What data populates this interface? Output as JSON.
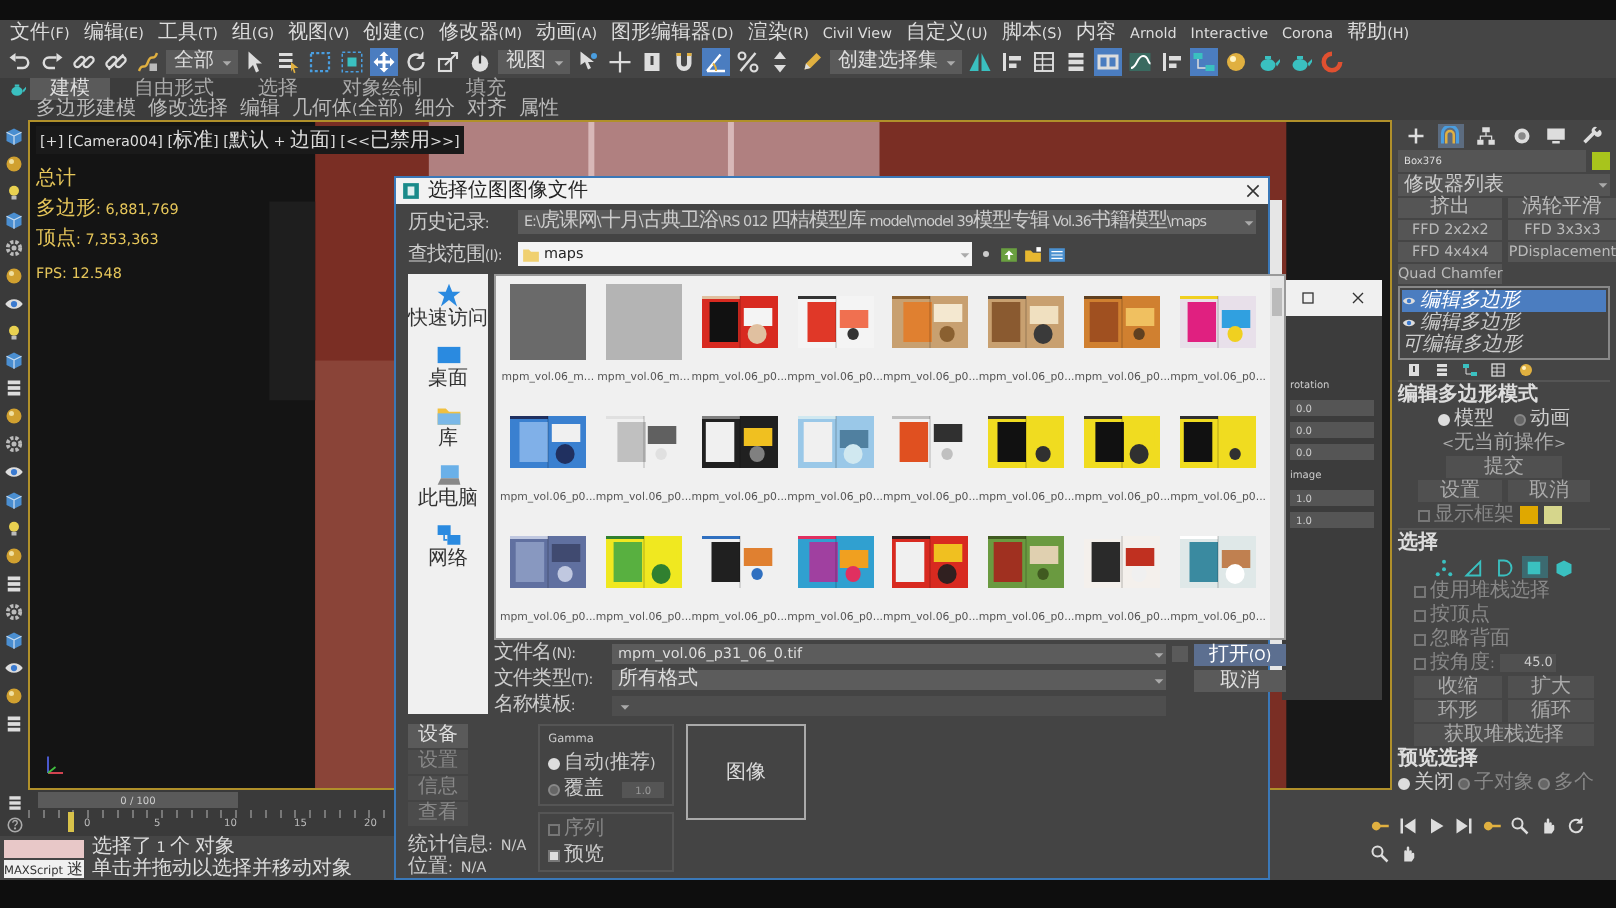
{
  "menu": [
    "文件(F)",
    "编辑(E)",
    "工具(T)",
    "组(G)",
    "视图(V)",
    "创建(C)",
    "修改器(M)",
    "动画(A)",
    "图形编辑器(D)",
    "渲染(R)",
    "Civil View",
    "自定义(U)",
    "脚本(S)",
    "内容",
    "Arnold",
    "Interactive",
    "Corona",
    "帮助(H)"
  ],
  "toolbar": [
    {
      "kind": "undo",
      "selected": false
    },
    {
      "kind": "redo",
      "selected": false
    },
    {
      "kind": "link",
      "selected": false
    },
    {
      "kind": "unlink",
      "selected": false
    },
    {
      "kind": "bind",
      "selected": false
    },
    {
      "kind": "dropdown",
      "text": "全部"
    },
    {
      "kind": "select",
      "selected": false
    },
    {
      "kind": "list",
      "selected": false
    },
    {
      "kind": "rect-select",
      "selected": false
    },
    {
      "kind": "window-select",
      "selected": false
    },
    {
      "kind": "move",
      "selected": true
    },
    {
      "kind": "rotate",
      "selected": false
    },
    {
      "kind": "scale",
      "selected": false
    },
    {
      "kind": "place",
      "selected": false
    },
    {
      "kind": "dropdown",
      "text": "视图"
    },
    {
      "kind": "pivot",
      "selected": false
    },
    {
      "kind": "crosshair",
      "selected": false
    },
    {
      "kind": "pin",
      "selected": false
    },
    {
      "kind": "snap",
      "selected": false
    },
    {
      "kind": "angle",
      "selected": true
    },
    {
      "kind": "percent",
      "selected": false
    },
    {
      "kind": "spinner",
      "selected": false
    },
    {
      "kind": "pencil",
      "selected": false
    },
    {
      "kind": "dropdown",
      "text": "创建选择集"
    },
    {
      "kind": "mirror",
      "selected": false
    },
    {
      "kind": "align",
      "selected": false
    },
    {
      "kind": "table",
      "selected": false
    },
    {
      "kind": "layers",
      "selected": false
    },
    {
      "kind": "ribbon",
      "selected": true
    },
    {
      "kind": "curve",
      "selected": false
    },
    {
      "kind": "align",
      "selected": false
    },
    {
      "kind": "schematic",
      "selected": true
    },
    {
      "kind": "material",
      "selected": false
    },
    {
      "kind": "teapot",
      "selected": false
    },
    {
      "kind": "teapot",
      "selected": false
    },
    {
      "kind": "render",
      "selected": false
    }
  ],
  "ribbon": {
    "tabs": [
      {
        "label": "建模",
        "selected": true
      },
      {
        "label": "自由形式",
        "selected": false
      },
      {
        "label": "选择",
        "selected": false
      },
      {
        "label": "对象绘制",
        "selected": false
      },
      {
        "label": "填充",
        "selected": false
      }
    ],
    "items": [
      "多边形建模",
      "修改选择",
      "编辑",
      "几何体(全部)",
      "细分",
      "对齐",
      "属性"
    ]
  },
  "left_toolbar": [
    {
      "kind": "box"
    },
    {
      "kind": "sphere"
    },
    {
      "kind": "light"
    },
    {
      "kind": "box"
    },
    {
      "kind": "gear"
    },
    {
      "kind": "sphere"
    },
    {
      "kind": "eye"
    },
    {
      "kind": "light"
    },
    {
      "kind": "box"
    },
    {
      "kind": "layers"
    },
    {
      "kind": "sphere"
    },
    {
      "kind": "gear"
    },
    {
      "kind": "eye"
    },
    {
      "kind": "box"
    },
    {
      "kind": "light"
    },
    {
      "kind": "sphere"
    },
    {
      "kind": "layers"
    },
    {
      "kind": "gear"
    },
    {
      "kind": "box"
    },
    {
      "kind": "eye"
    },
    {
      "kind": "sphere"
    },
    {
      "kind": "layers"
    }
  ],
  "viewport": {
    "label": "[+] [Camera004] [标准] [默认 + 边面] [<<已禁用>>]",
    "stats_title": "总计",
    "stats": [
      {
        "label": "多边形:",
        "value": "6,881,769"
      },
      {
        "label": "顶点:",
        "value": "7,353,363"
      }
    ],
    "fps": {
      "label": "FPS:",
      "value": "12.548"
    }
  },
  "command_panel": {
    "tabs": [
      {
        "kind": "create",
        "selected": false
      },
      {
        "kind": "modify",
        "selected": true
      },
      {
        "kind": "hierarchy",
        "selected": false
      },
      {
        "kind": "motion",
        "selected": false
      },
      {
        "kind": "display",
        "selected": false
      },
      {
        "kind": "utilities",
        "selected": false
      }
    ],
    "object": {
      "name": "Box376",
      "color": "#a8c41c"
    },
    "modifier_list": "修改器列表",
    "modifier_buttons": [
      "挤出",
      "涡轮平滑",
      "FFD 2x2x2",
      "FFD 3x3x3",
      "FFD 4x4x4",
      "PDisplacement",
      "Quad Chamfer"
    ],
    "stack": [
      {
        "label": "编辑多边形",
        "selected": true,
        "visible": true
      },
      {
        "label": "编辑多边形",
        "selected": false,
        "visible": true
      },
      {
        "label": "可编辑多边形",
        "selected": false,
        "visible": false
      }
    ],
    "edit_mode": {
      "title": "编辑多边形模式",
      "options": [
        {
          "label": "模型",
          "selected": true
        },
        {
          "label": "动画",
          "selected": false
        }
      ],
      "status": "<无当前操作>",
      "commit": "提交",
      "buttons": [
        "设置",
        "取消"
      ],
      "show_cage": {
        "label": "显示框架",
        "checked": false
      },
      "cage_colors": [
        {
          "color": "#e0a800"
        },
        {
          "color": "#d6d68c"
        }
      ]
    },
    "selection": {
      "title": "选择",
      "levels": [
        {
          "kind": "vertex",
          "selected": false
        },
        {
          "kind": "edge",
          "selected": false
        },
        {
          "kind": "border",
          "selected": false
        },
        {
          "kind": "polygon",
          "selected": true
        },
        {
          "kind": "element",
          "selected": false
        }
      ],
      "checks": [
        {
          "label": "使用堆栈选择",
          "checked": false
        },
        {
          "label": "按顶点",
          "checked": false
        },
        {
          "label": "忽略背面",
          "checked": false
        },
        {
          "label": "按角度:",
          "checked": false,
          "value": "45.0"
        }
      ],
      "buttons": [
        "收缩",
        "扩大",
        "环形",
        "循环"
      ],
      "get_stack": "获取堆栈选择",
      "preview": {
        "title": "预览选择",
        "options": [
          {
            "label": "关闭",
            "selected": true
          },
          {
            "label": "子对象",
            "selected": false
          },
          {
            "label": "多个",
            "selected": false
          }
        ]
      }
    }
  },
  "timeline": {
    "frame": "0 / 100",
    "level": 0,
    "ticks": [
      "0",
      "5",
      "10",
      "15",
      "20"
    ]
  },
  "status_bar": {
    "script_label": "MAXScript 迷",
    "selection": "选择了 1 个 对象",
    "prompt": "单击并拖动以选择并移动对象"
  },
  "background_window": {
    "sections": [
      {
        "title": "rotation",
        "fields": [
          "0.0",
          "0.0",
          "0.0"
        ]
      },
      {
        "title": "image",
        "fields": [
          "1.0",
          "1.0"
        ]
      }
    ]
  },
  "dialog": {
    "title": "选择位图图像文件",
    "history": {
      "label": "历史记录:",
      "value": "E:\\虎课网\\十月\\古典卫浴\\RS 012 四桔模型库 model\\model 39模型专辑 Vol.36书籍模型\\maps"
    },
    "look_in": {
      "label": "查找范围(I):",
      "value": "maps"
    },
    "places": [
      "快速访问",
      "桌面",
      "库",
      "此电脑",
      "网络"
    ],
    "files": [
      {
        "name": "mpm_vol.06_m...",
        "kind": "placeholder",
        "color": "#6a6a6a"
      },
      {
        "name": "mpm_vol.06_m...",
        "kind": "placeholder",
        "color": "#b4b4b4"
      },
      {
        "name": "mpm_vol.06_p0...",
        "kind": "picture"
      },
      {
        "name": "mpm_vol.06_p0...",
        "kind": "picture"
      },
      {
        "name": "mpm_vol.06_p0...",
        "kind": "picture"
      },
      {
        "name": "mpm_vol.06_p0...",
        "kind": "picture"
      },
      {
        "name": "mpm_vol.06_p0...",
        "kind": "picture"
      },
      {
        "name": "mpm_vol.06_p0...",
        "kind": "picture"
      },
      {
        "name": "mpm_vol.06_p0...",
        "kind": "picture"
      },
      {
        "name": "mpm_vol.06_p0...",
        "kind": "picture"
      },
      {
        "name": "mpm_vol.06_p0...",
        "kind": "picture"
      },
      {
        "name": "mpm_vol.06_p0...",
        "kind": "picture"
      },
      {
        "name": "mpm_vol.06_p0...",
        "kind": "picture"
      },
      {
        "name": "mpm_vol.06_p0...",
        "kind": "picture"
      },
      {
        "name": "mpm_vol.06_p0...",
        "kind": "picture"
      },
      {
        "name": "mpm_vol.06_p0...",
        "kind": "picture"
      },
      {
        "name": "mpm_vol.06_p0...",
        "kind": "picture"
      },
      {
        "name": "mpm_vol.06_p0...",
        "kind": "picture"
      },
      {
        "name": "mpm_vol.06_p0...",
        "kind": "picture"
      },
      {
        "name": "mpm_vol.06_p0...",
        "kind": "picture"
      },
      {
        "name": "mpm_vol.06_p0...",
        "kind": "picture"
      },
      {
        "name": "mpm_vol.06_p0...",
        "kind": "picture"
      },
      {
        "name": "mpm_vol.06_p0...",
        "kind": "picture"
      },
      {
        "name": "mpm_vol.06_p0...",
        "kind": "picture"
      }
    ],
    "fields": [
      {
        "label": "文件名(N):",
        "value": "mpm_vol.06_p31_06_0.tif"
      },
      {
        "label": "文件类型(T):",
        "value": "所有格式"
      },
      {
        "label": "名称模板:"
      }
    ],
    "open": "打开(O)",
    "cancel": "取消",
    "side_buttons": [
      {
        "label": "设备",
        "disabled": false
      },
      {
        "label": "设置",
        "disabled": true
      },
      {
        "label": "信息",
        "disabled": true
      },
      {
        "label": "查看",
        "disabled": true
      }
    ],
    "gamma": {
      "title": "Gamma",
      "options": [
        {
          "label": "自动(推荐)",
          "selected": true
        },
        {
          "label": "覆盖",
          "selected": false
        }
      ],
      "override_value": "1.0"
    },
    "options": [
      {
        "label": "序列",
        "checked": false,
        "disabled": true
      },
      {
        "label": "预览",
        "checked": true,
        "disabled": false
      }
    ],
    "preview": "图像",
    "info": [
      {
        "label": "统计信息:",
        "value": "N/A"
      },
      {
        "label": "位置:",
        "value": "N/A"
      }
    ]
  }
}
